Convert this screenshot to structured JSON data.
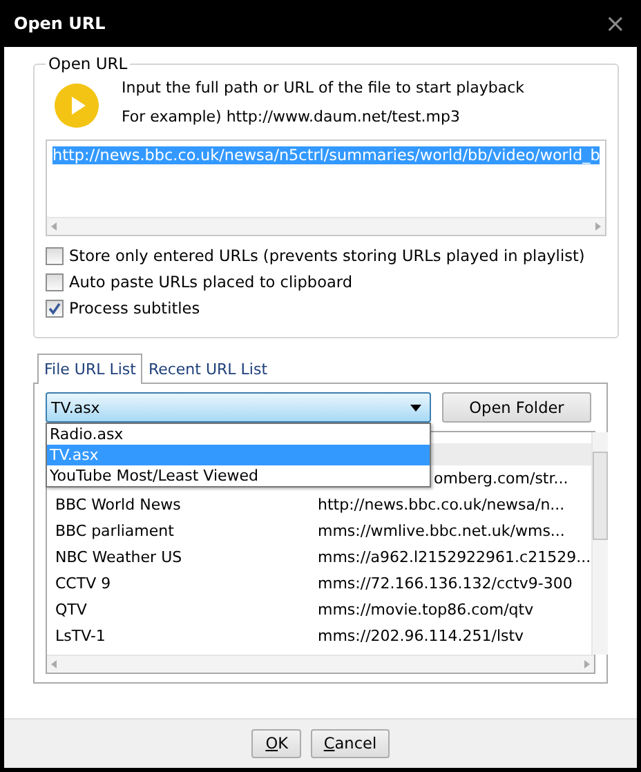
{
  "window": {
    "title": "Open URL",
    "close": "×"
  },
  "url_group": {
    "legend": "Open URL",
    "instruction": "Input the full path or URL of the file to start playback",
    "example": "For example) http://www.daum.net/test.mp3",
    "url": "http://news.bbc.co.uk/newsa/n5ctrl/summaries/world/bb/video/world_b"
  },
  "options": [
    {
      "label": "Store only entered URLs (prevents storing URLs played in playlist)",
      "checked": false
    },
    {
      "label": "Auto paste URLs placed to clipboard",
      "checked": false
    },
    {
      "label": "Process subtitles",
      "checked": true
    }
  ],
  "tabs": [
    {
      "label": "File URL List",
      "selected": true
    },
    {
      "label": "Recent URL List",
      "selected": false
    }
  ],
  "file_list": {
    "value": "TV.asx",
    "expanded": true,
    "options": [
      {
        "label": "Radio.asx",
        "selected": false
      },
      {
        "label": "TV.asx",
        "selected": true
      },
      {
        "label": "YouTube Most/Least Viewed",
        "selected": false
      }
    ],
    "open_folder": "Open Folder"
  },
  "rows": [
    {
      "url": "omberg.com/str..."
    },
    {
      "name": "BBC World News",
      "url": "http://news.bbc.co.uk/newsa/n..."
    },
    {
      "name": "BBC parliament",
      "url": "mms://wmlive.bbc.net.uk/wms..."
    },
    {
      "name": "NBC Weather US",
      "url": "mms://a962.l2152922961.c21529..."
    },
    {
      "name": "CCTV 9",
      "url": "mms://72.166.136.132/cctv9-300"
    },
    {
      "name": "QTV",
      "url": "mms://movie.top86.com/qtv"
    },
    {
      "name": "LsTV-1",
      "url": "mms://202.96.114.251/lstv"
    }
  ],
  "buttons": [
    "OK",
    "Cancel"
  ]
}
